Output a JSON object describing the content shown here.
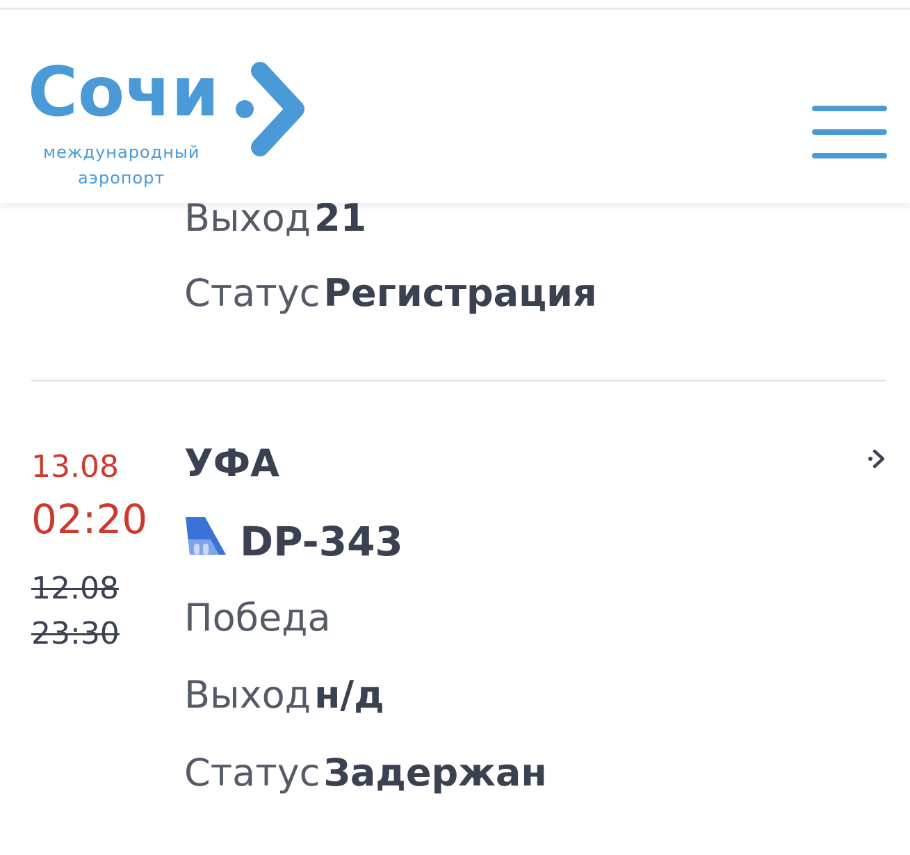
{
  "header": {
    "logo_title": "Сочи",
    "logo_subtitle_line1": "международный",
    "logo_subtitle_line2": "аэропорт",
    "menu_icon": "hamburger-menu-icon",
    "brand_color": "#4a9ad8"
  },
  "flights": [
    {
      "gate_label": "Выход",
      "gate_value": "21",
      "status_label": "Статус",
      "status_value": "Регистрация"
    },
    {
      "new_date": "13.08",
      "new_time": "02:20",
      "old_date": "12.08",
      "old_time": "23:30",
      "destination": "УФА",
      "flight_number": "DP-343",
      "airline": "Победа",
      "gate_label": "Выход",
      "gate_value": "н/д",
      "status_label": "Статус",
      "status_value": "Задержан",
      "delay_color": "#cc3a2f",
      "details_icon": "chevron-right-icon",
      "airline_icon": "airline-tail-icon"
    }
  ]
}
